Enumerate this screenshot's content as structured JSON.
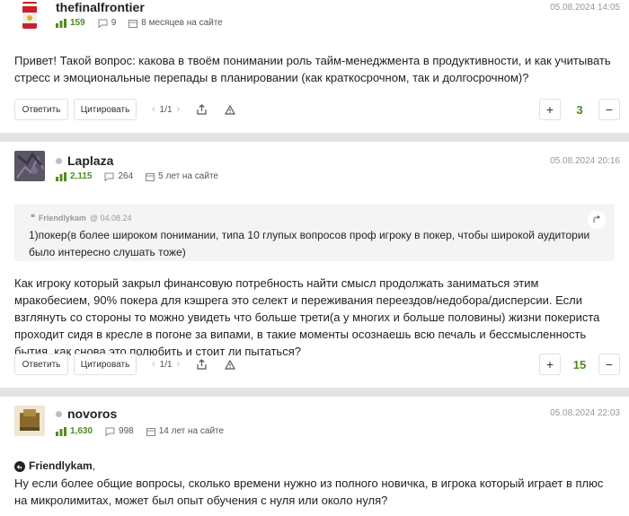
{
  "posts": [
    {
      "author": "thefinalfrontier",
      "rating": "159",
      "comments": "9",
      "on_site": "8 месяцев на сайте",
      "date": "05.08.2024 14:05",
      "text": "Привет! Такой вопрос: какова в твоём понимании роль тайм-менеджмента в продуктивности, и как учитывать стресс и эмоциональные перепады в планировании (как краткосрочном, так и долгосрочном)?",
      "votes": "3",
      "pager": "1/1"
    },
    {
      "author": "Laplaza",
      "rating": "2,115",
      "comments": "264",
      "on_site": "5 лет на сайте",
      "date": "05.08.2024 20:16",
      "quote": {
        "author": "Friendlykam",
        "date": "@ 04.08.24",
        "text": "1)покер(в более широком понимании, типа 10 глупых вопросов проф игроку в покер, чтобы широкой аудитории было интересно слушать тоже)"
      },
      "text": "Как игроку который закрыл финансовую потребность найти смысл продолжать заниматься этим мракобесием, 90% покера для кэшрега это селект и переживания переездов/недобора/дисперсии. Если взглянуть со стороны то можно увидеть что больше трети(а у многих и больше половины) жизни покериста проходит сидя в кресле в погоне за випами, в такие моменты осознаешь всю печаль и бессмысленность бытия, как снова это полюбить и стоит ли пытаться?",
      "votes": "15",
      "pager": "1/1"
    },
    {
      "author": "novoros",
      "rating": "1,630",
      "comments": "998",
      "on_site": "14 лет на сайте",
      "date": "05.08.2024 22:03",
      "mention": "Friendlykam",
      "mention_suffix": ",",
      "text": "Ну если более общие вопросы, сколько времени нужно из полного новичка, в игрока который играет в плюс на микролимитах, может был опыт обучения с нуля или около нуля?"
    }
  ],
  "labels": {
    "reply": "Ответить",
    "quote": "Цитировать",
    "plus": "+",
    "minus": "−"
  },
  "icons": {
    "rating": "rating-bars-icon",
    "comments": "comment-bubble-icon",
    "calendar": "calendar-icon",
    "share": "share-icon",
    "report": "warning-triangle-icon",
    "quote_jump": "jump-arrow-icon",
    "mention": "reply-arrow-icon"
  },
  "colors": {
    "accent_green": "#4e8c1f",
    "separator": "#e3e3e3",
    "quote_bg": "#f4f4f4"
  }
}
